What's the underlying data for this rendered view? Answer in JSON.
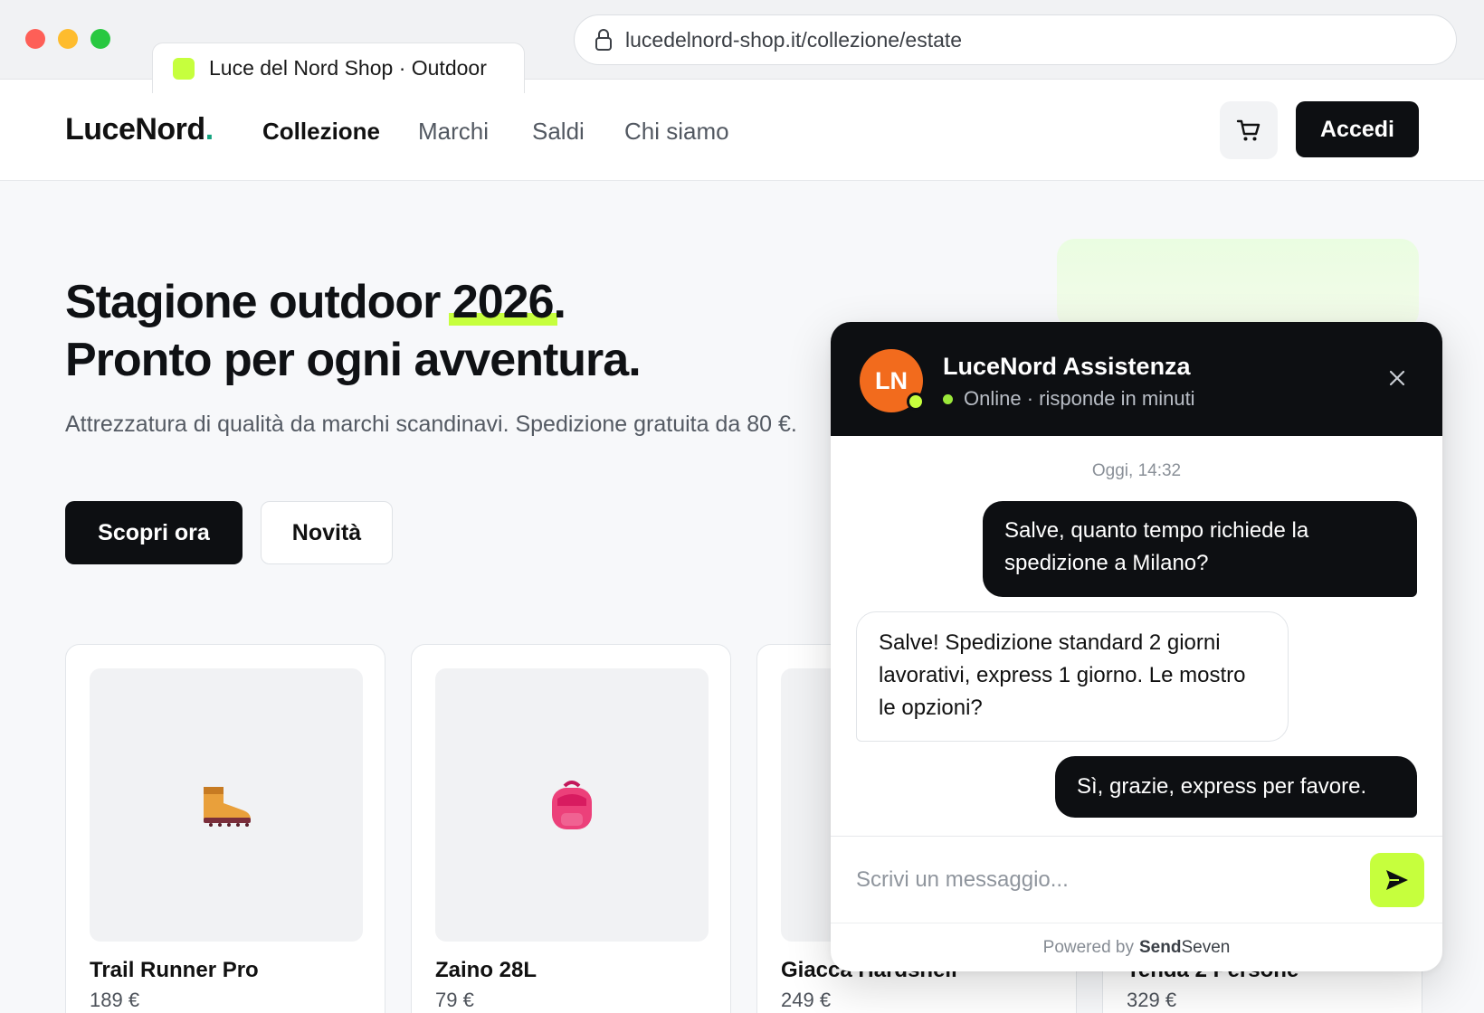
{
  "browser": {
    "tab_title": "Luce del Nord Shop · Outdoor",
    "url": "lucedelnord-shop.it/collezione/estate",
    "favicon_color": "#c6ff3d"
  },
  "nav": {
    "logo_text": "LuceNord",
    "logo_accent": ".",
    "links": [
      "Collezione",
      "Marchi",
      "Saldi",
      "Chi siamo"
    ],
    "active_link": "Collezione",
    "cart_icon": "cart-icon",
    "login_label": "Accedi"
  },
  "hero": {
    "title_part1": "Stagione outdoor ",
    "title_highlight": "2026",
    "title_part2": ".",
    "title_line2": "Pronto per ogni avventura.",
    "subtitle": "Attrezzatura di qualità da marchi scandinavi. Spedizione gratuita da 80 €.",
    "primary_cta": "Scopri ora",
    "secondary_cta": "Novità"
  },
  "products": [
    {
      "name": "Trail Runner Pro",
      "price": "189 €",
      "icon": "hiking-boot-icon"
    },
    {
      "name": "Zaino 28L",
      "price": "79 €",
      "icon": "backpack-icon"
    },
    {
      "name": "Giacca Hardshell",
      "price": "249 €",
      "icon": ""
    },
    {
      "name": "Tenda 2 Persone",
      "price": "329 €",
      "icon": ""
    }
  ],
  "chat": {
    "avatar_initials": "LN",
    "agent_name": "LuceNord Assistenza",
    "status": "Online · risponde in minuti",
    "timestamp": "Oggi, 14:32",
    "messages": [
      {
        "from": "user",
        "text": "Salve, quanto tempo richiede la spedizione a Milano?"
      },
      {
        "from": "agent",
        "text": "Salve! Spedizione standard 2 giorni lavorativi, express 1 giorno. Le mostro le opzioni?"
      },
      {
        "from": "user",
        "text": "Sì, grazie, express per favore."
      }
    ],
    "input_placeholder": "Scrivi un messaggio...",
    "powered_by": "Powered by",
    "brand_bold": "Send",
    "brand_rest": "Seven"
  },
  "colors": {
    "accent_lime": "#c6ff3d",
    "dark": "#0d0f12",
    "avatar_orange": "#f26b1d",
    "logo_dot": "#14a37f"
  }
}
